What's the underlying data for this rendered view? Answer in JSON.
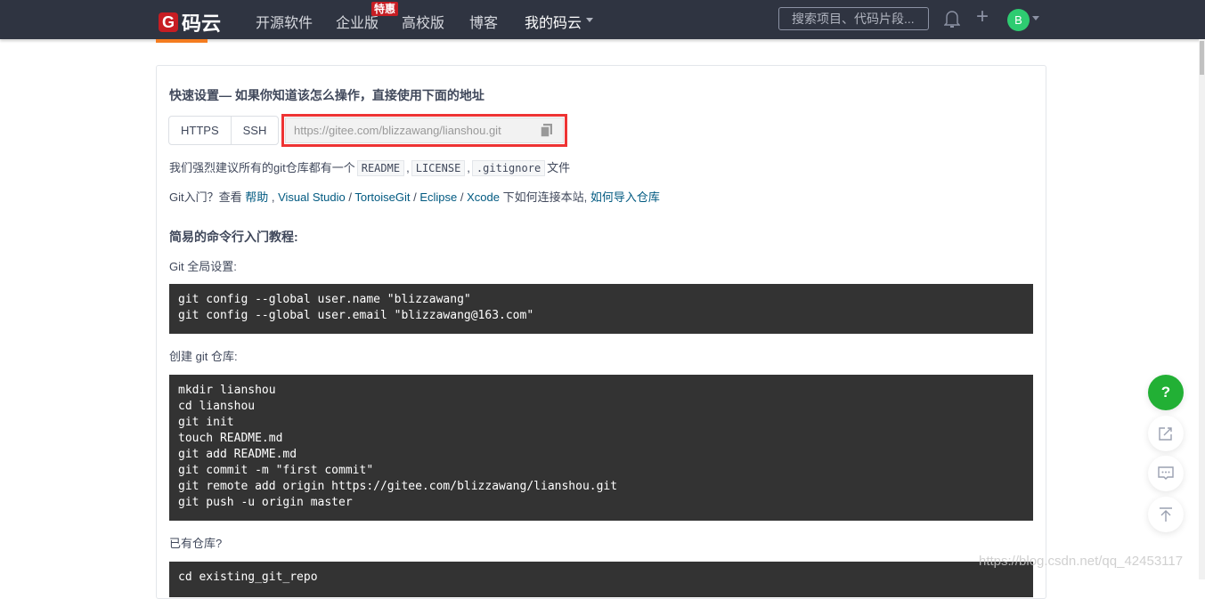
{
  "nav": {
    "logo_text": "码云",
    "items": [
      "开源软件",
      "企业版",
      "高校版",
      "博客",
      "我的码云"
    ],
    "badge": "特惠",
    "search_placeholder": "搜索项目、代码片段...",
    "avatar_letter": "B"
  },
  "setup": {
    "title": "快速设置— 如果你知道该怎么操作，直接使用下面的地址",
    "protocols": [
      "HTTPS",
      "SSH"
    ],
    "url": "https://gitee.com/blizzawang/lianshou.git",
    "recommend_prefix": "我们强烈建议所有的git仓库都有一个",
    "files": [
      "README",
      "LICENSE",
      ".gitignore"
    ],
    "recommend_suffix": "文件",
    "help_prefix": "Git入门？查看 ",
    "help_links": [
      "帮助",
      "Visual Studio",
      "TortoiseGit",
      "Eclipse",
      "Xcode"
    ],
    "help_suffix": " 下如何连接本站,",
    "help_import": "如何导入仓库"
  },
  "tutorial": {
    "title": "简易的命令行入门教程:",
    "sections": [
      {
        "label": "Git 全局设置:",
        "code": "git config --global user.name \"blizzawang\"\ngit config --global user.email \"blizzawang@163.com\""
      },
      {
        "label": "创建 git 仓库:",
        "code": "mkdir lianshou\ncd lianshou\ngit init\ntouch README.md\ngit add README.md\ngit commit -m \"first commit\"\ngit remote add origin https://gitee.com/blizzawang/lianshou.git\ngit push -u origin master"
      },
      {
        "label": "已有仓库?",
        "code": "cd existing_git_repo"
      }
    ]
  },
  "fab": {
    "help": "?"
  },
  "watermark": "https://blog.csdn.net/qq_42453117"
}
